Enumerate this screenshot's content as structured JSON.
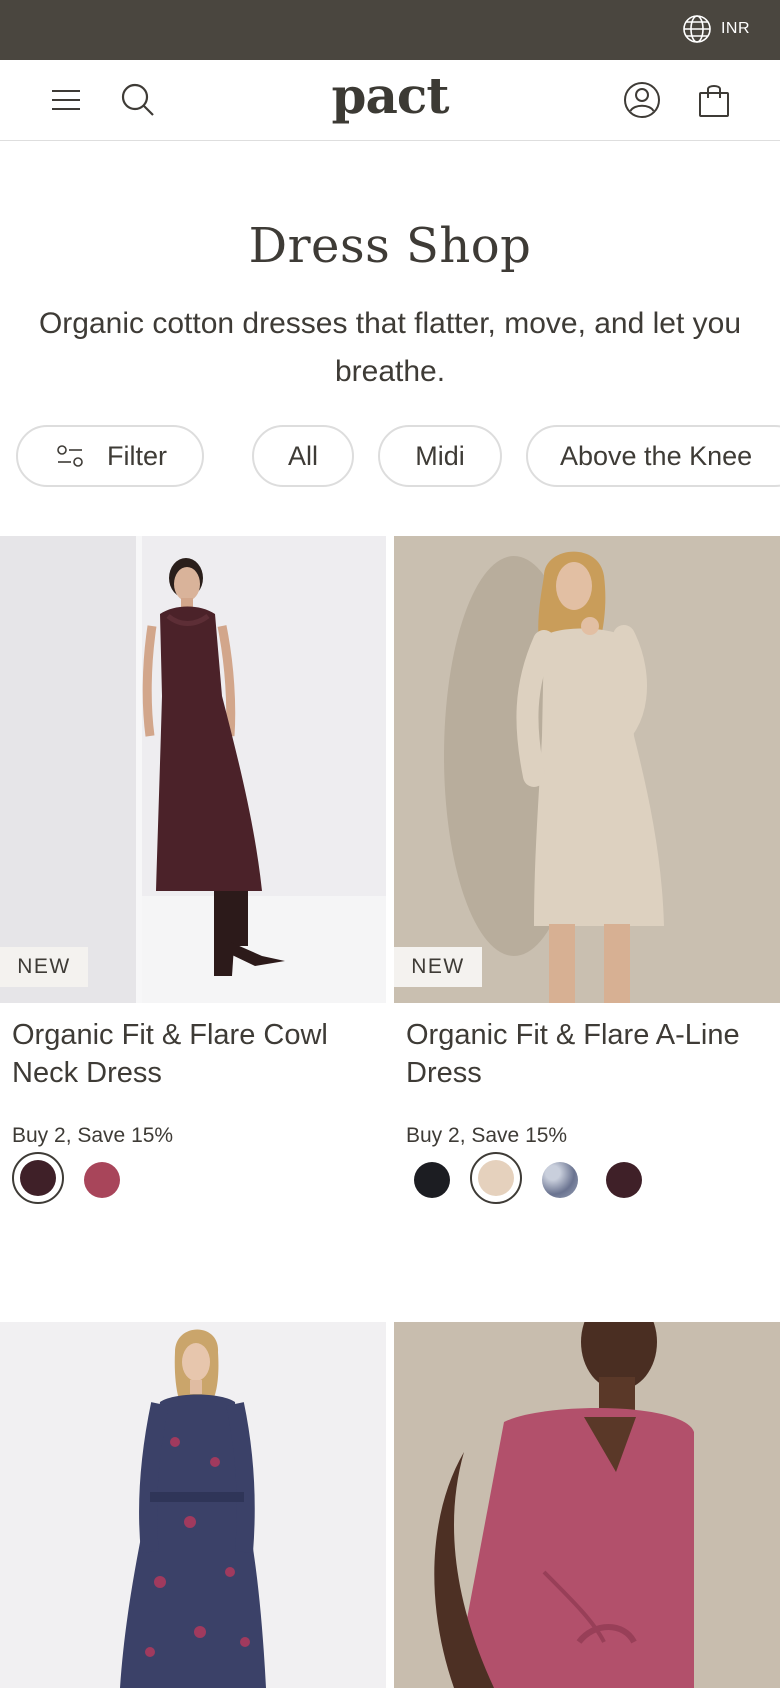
{
  "topbar": {
    "currency": "INR",
    "icon": "globe-icon"
  },
  "header": {
    "logo": "pact",
    "icons": [
      "menu-icon",
      "search-icon",
      "account-icon",
      "bag-icon"
    ]
  },
  "page": {
    "title": "Dress Shop",
    "subtitle": "Organic cotton dresses that flatter, move, and let you breathe."
  },
  "filters": {
    "filter_label": "Filter",
    "pills": [
      "All",
      "Midi",
      "Above the Knee"
    ]
  },
  "products": [
    {
      "badge": "NEW",
      "name": "Organic Fit & Flare Cowl Neck Dress",
      "promo": "Buy 2, Save 15%",
      "swatches": [
        "#3f2028",
        "#a8455a"
      ],
      "selected_swatch": 0
    },
    {
      "badge": "NEW",
      "name": "Organic Fit & Flare A-Line Dress",
      "promo": "Buy 2, Save 15%",
      "swatches": [
        "#1c1d22",
        "#e5d1bd",
        "#8a92a8",
        "#3f2028"
      ],
      "selected_swatch": 1
    },
    {
      "badge": "",
      "name": "",
      "promo": ""
    },
    {
      "badge": "",
      "name": "",
      "promo": ""
    }
  ],
  "colors": {
    "topbar_bg": "#4a463f",
    "text": "#3e3b36",
    "pill_border": "#dddddd"
  }
}
